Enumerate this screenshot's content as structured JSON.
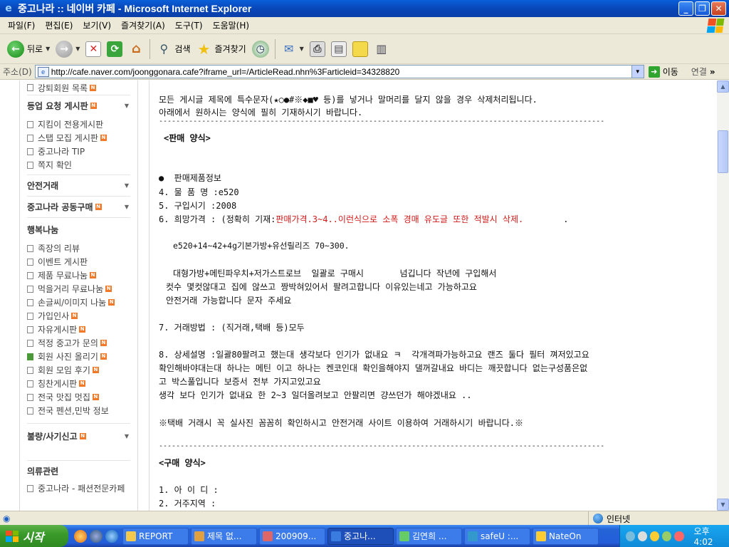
{
  "window": {
    "title": "중고나라 :: 네이버 카페 - Microsoft Internet Explorer"
  },
  "menu": [
    "파일(F)",
    "편집(E)",
    "보기(V)",
    "즐겨찾기(A)",
    "도구(T)",
    "도움말(H)"
  ],
  "toolbar": {
    "back": "뒤로",
    "search": "검색",
    "favorites": "즐겨찾기"
  },
  "address": {
    "label": "주소(D)",
    "url": "http://cafe.naver.com/joonggonara.cafe?iframe_url=/ArticleRead.nhn%3Farticleid=34328820",
    "go": "이동",
    "links": "연결"
  },
  "sidebar": {
    "top_item": "강퇴회원 목록",
    "groups": [
      {
        "title": "등업 요청 게시판",
        "badge": true,
        "items": [
          {
            "label": "지킴이 전용게시판",
            "badge": false
          },
          {
            "label": "스탭 모집 게시판",
            "badge": true
          },
          {
            "label": "중고나라 TIP",
            "badge": false
          },
          {
            "label": "쪽지 확인",
            "badge": false
          }
        ]
      },
      {
        "title": "안전거래",
        "badge": false,
        "items": []
      },
      {
        "title": "중고나라 공동구매",
        "badge": true,
        "items": []
      }
    ],
    "share_title": "행복나눔",
    "share_items": [
      {
        "label": "족장의 리뷰",
        "badge": false
      },
      {
        "label": "이벤트 게시판",
        "badge": false
      },
      {
        "label": "제품 무료나눔",
        "badge": true
      },
      {
        "label": "먹을거리 무료나눔",
        "badge": true
      },
      {
        "label": "손글씨/이미지 나눔",
        "badge": true
      },
      {
        "label": "가입인사",
        "badge": true
      },
      {
        "label": "자유게시판",
        "badge": true
      },
      {
        "label": "적정 중고가 문의",
        "badge": true
      },
      {
        "label": "회원 사진 올리기",
        "badge": true
      },
      {
        "label": "회원 모임 후기",
        "badge": true
      },
      {
        "label": "칭찬게시판",
        "badge": true
      },
      {
        "label": "전국 맛집 멋집",
        "badge": true
      },
      {
        "label": "전국 펜션,민박 정보",
        "badge": false
      }
    ],
    "report_title": "불량/사기신고",
    "clothing_title": "의류관련",
    "clothing_items": [
      {
        "label": "중고나라 - 패션전문카페",
        "badge": false
      }
    ]
  },
  "article": {
    "notice1": "모든 게시글 제목에 특수문자(★○●#※◆■♥ 등)를 넣거나 말머리를 달지 않을 경우 삭제처리됩니다.",
    "notice2": "아래에서 원하시는 양식에 필히 기재하시기 바랍니다.",
    "sale_header": "<판매 양식>",
    "product_info": "●  판매제품정보",
    "item_name": "4. 물 품 명 :e520",
    "purchase_date": "5. 구입시기 :2008",
    "price_prefix": "6. 희망가격 : (정확히 기재:",
    "price_warning": "판매가격.3~4..이런식으로 소폭 경매 유도글 또한 적발시 삭제.",
    "price_tail": ".",
    "price_detail": "e520+14~42+4g기본가방+유선릴리즈 70~300.",
    "desc1": "대형가방+메틴파우치+저가스트로브  일괄로 구매시       넘깁니다 작년에 구입해서",
    "desc2": "컷수 몇컷않대고 집에 않쓰고 짱박혀있어서 팔려고합니다 이유있는네고 가능하고요",
    "desc3": "안전거래 가능합니다 문자 주세요",
    "method": "7. 거래방법 : (직거래,택배 등)모두",
    "detail1": "8. 상세설명 :일괄80팔려고 했는대 생각보다 인기가 없내요 ㅋ  각개격파가능하고요 랜즈 둘다 필터 껴저있고요",
    "detail2": "확인해바야대는대 하나는 메틴 이고 하나는 켄코인대 확인을해야지 댈꺼갈내요 바디는 깨끗합니다 없는구성품은없",
    "detail3": "고 박스풀입니다 보증서 전부 가지고있고요",
    "detail4": "생각 보다 인기가 없내요 한 2~3 일더올려보고 안팔리면 걍쓰던가 해야겠내요 ..",
    "delivery_note": "※택배 거래시 꼭 실사진 꼼꼼히 확인하시고 안전거래 사이트 이용하여 거래하시기 바랍니다.※",
    "buy_header": "<구매 양식>",
    "buy_id": "1. 아 이 디 :",
    "buy_region": "2. 거주지역 :",
    "divider": "--------------------------------------------------------------------------------------------------------"
  },
  "status": {
    "zone": "인터넷"
  },
  "taskbar": {
    "start": "시작",
    "tasks": [
      "REPORT",
      "제목 없...",
      "200909...",
      "중고나...",
      "김연희 ...",
      "safeU :...",
      "NateOn"
    ],
    "clock": "오후 4:02"
  }
}
